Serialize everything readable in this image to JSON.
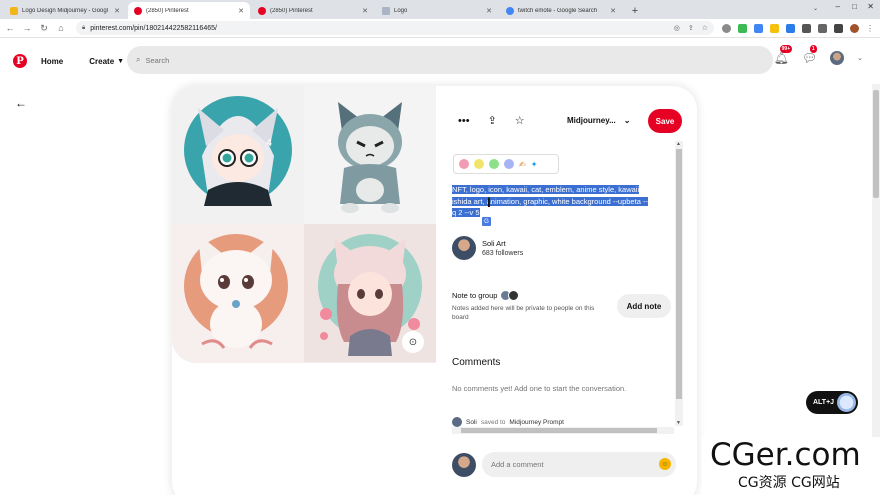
{
  "browser": {
    "tabs": [
      {
        "title": "Logo Design Midjourney - Googl",
        "favicon_color": "#f2b61b",
        "active": false
      },
      {
        "title": "(2850) Pinterest",
        "favicon_color": "#e60023",
        "active": true
      },
      {
        "title": "(2850) Pinterest",
        "favicon_color": "#e60023",
        "active": false
      },
      {
        "title": "Logo",
        "favicon_color": "#aab4c4",
        "active": false
      },
      {
        "title": "twitch emote - Google Search",
        "favicon_color": "#4285f4",
        "active": false
      }
    ],
    "new_tab_label": "+",
    "url": "pinterest.com/pin/180214422582116465/"
  },
  "header": {
    "logo_letter": "P",
    "home_label": "Home",
    "create_label": "Create",
    "search_placeholder": "Search",
    "notifications_badge": "99+",
    "messages_badge": "1"
  },
  "pin": {
    "board_name": "Midjourney...",
    "save_label": "Save",
    "color_dots": [
      "#f39bb5",
      "#f1e46a",
      "#8ee08a",
      "#a6b4f5"
    ],
    "description_lines": [
      "NFT, logo, icon, kawaii, cat, emblem, anime style, kawaii",
      "ishida art, animation, graphic, white background --upbeta --",
      "q 2 --v 5"
    ],
    "creator": {
      "name": "Soli Art",
      "followers": "683 followers"
    },
    "note": {
      "title": "Note to group",
      "subtitle": "Notes added here will be private to people on this board",
      "add_label": "Add note"
    },
    "comments": {
      "heading": "Comments",
      "empty_text": "No comments yet! Add one to start the conversation.",
      "placeholder": "Add a comment"
    },
    "activity": {
      "user": "Soli",
      "action": "saved to",
      "board": "Midjourney Prompt"
    }
  },
  "floating": {
    "shortcut_label": "ALT+J"
  },
  "watermark": {
    "main": "CGer.com",
    "sub": "CG资源 CG网站"
  }
}
